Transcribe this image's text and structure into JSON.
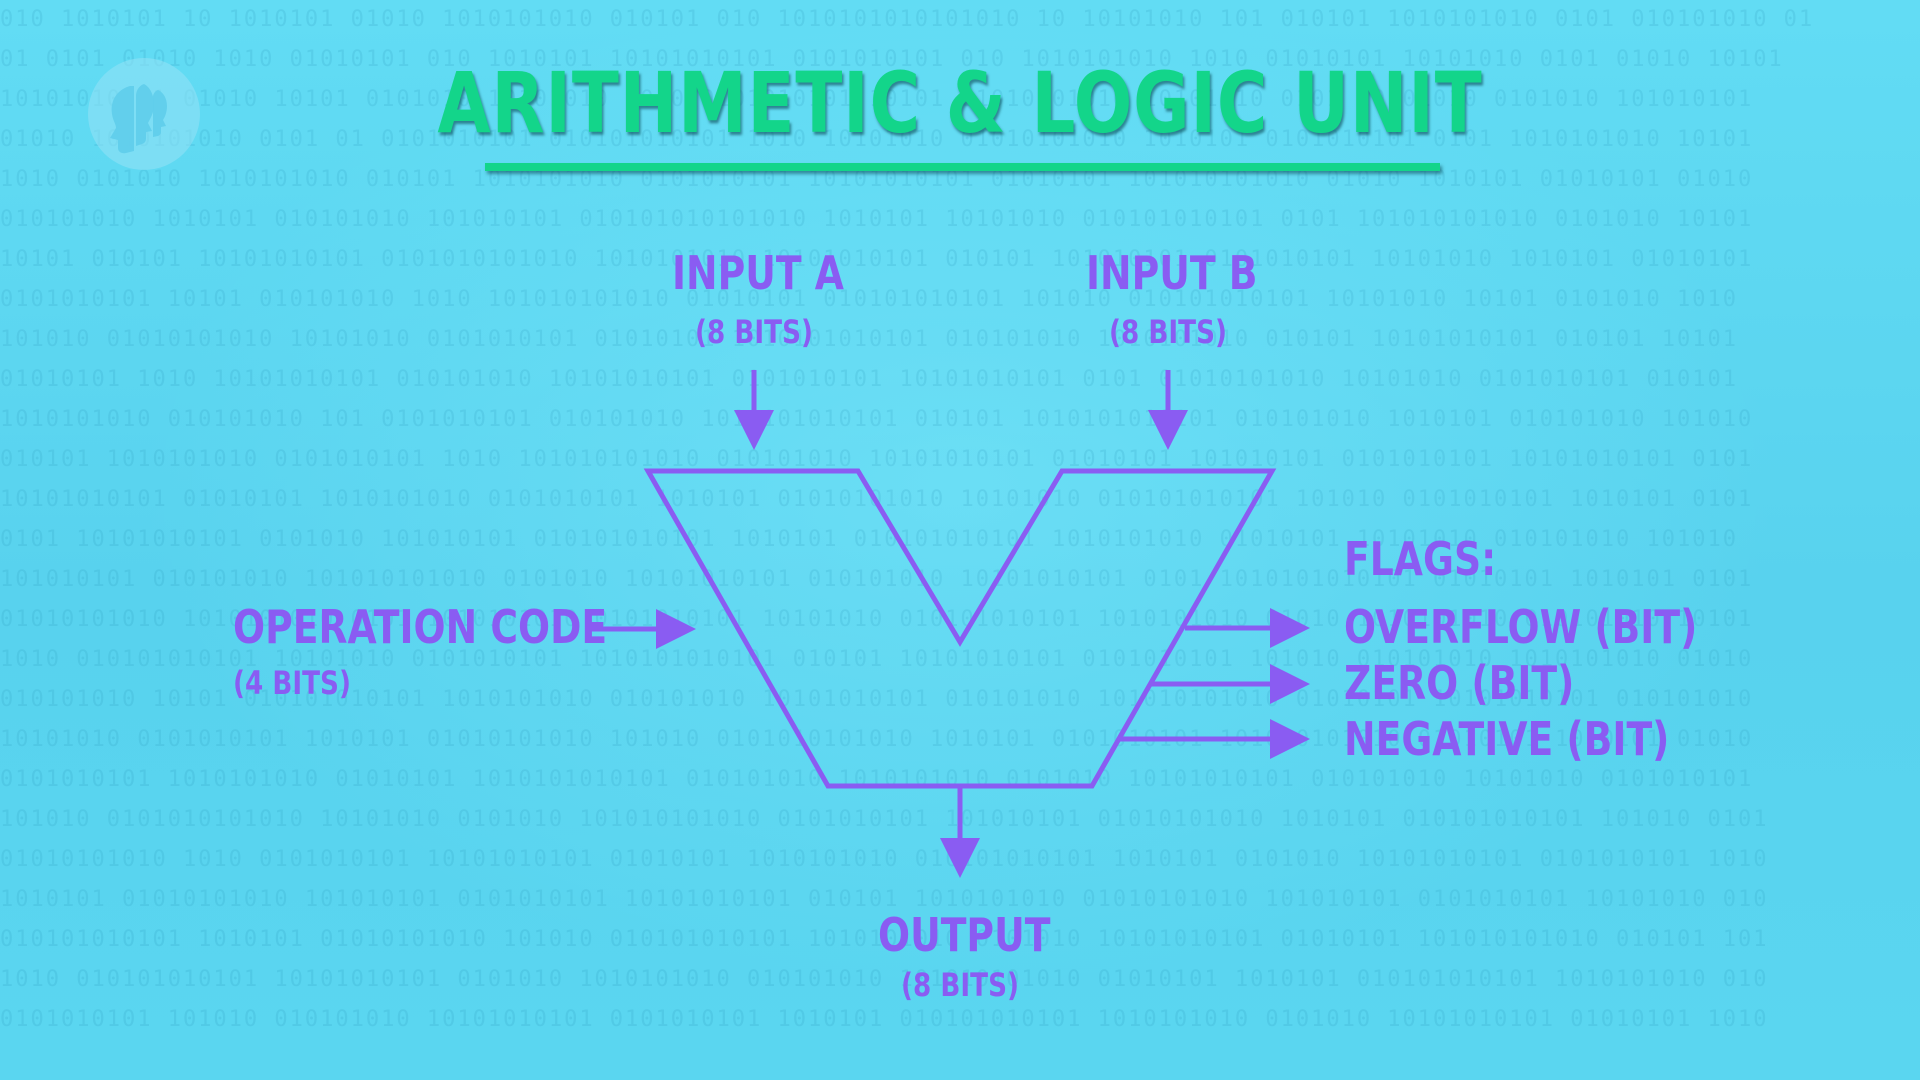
{
  "title": "ARITHMETIC & LOGIC UNIT",
  "inputs": {
    "a": {
      "label": "INPUT A",
      "bits": "(8 BITS)"
    },
    "b": {
      "label": "INPUT B",
      "bits": "(8 BITS)"
    }
  },
  "opcode": {
    "label": "OPERATION CODE",
    "bits": "(4 BITS)"
  },
  "output": {
    "label": "OUTPUT",
    "bits": "(8 BITS)"
  },
  "flags": {
    "heading": "FLAGS:",
    "items": [
      "OVERFLOW (BIT)",
      "ZERO (BIT)",
      "NEGATIVE (BIT)"
    ]
  },
  "colors": {
    "title": "#13d58a",
    "diagram": "#8a5cf2",
    "background": "#5fd8f0"
  },
  "icons": {
    "logo": "pbs-logo-icon"
  }
}
